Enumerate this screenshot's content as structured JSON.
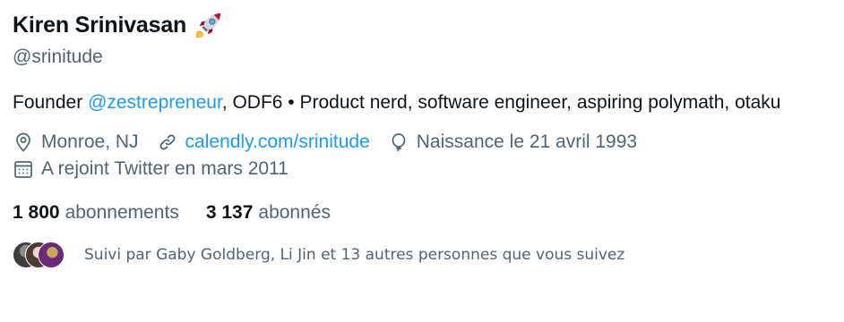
{
  "profile": {
    "display_name": "Kiren Srinivasan",
    "handle": "@srinitude",
    "badge_icon": "rocket-emoji-icon"
  },
  "bio": {
    "prefix": "Founder ",
    "mention": "@zestrepreneur",
    "suffix": ", ODF6 • Product nerd, software engineer, aspiring polymath, otaku"
  },
  "meta": {
    "location": "Monroe, NJ",
    "website": "calendly.com/srinitude",
    "birthday": "Naissance le 21 avril 1993",
    "joined": "A rejoint Twitter en mars 2011"
  },
  "stats": {
    "following_count": "1 800",
    "following_label": "abonnements",
    "followers_count": "3 137",
    "followers_label": "abonnés"
  },
  "followed_by": {
    "text": "Suivi par Gaby Goldberg, Li Jin et 13 autres personnes que vous suivez"
  },
  "colors": {
    "text_primary": "#0f1419",
    "text_secondary": "#536471",
    "link": "#1d9bf0"
  }
}
